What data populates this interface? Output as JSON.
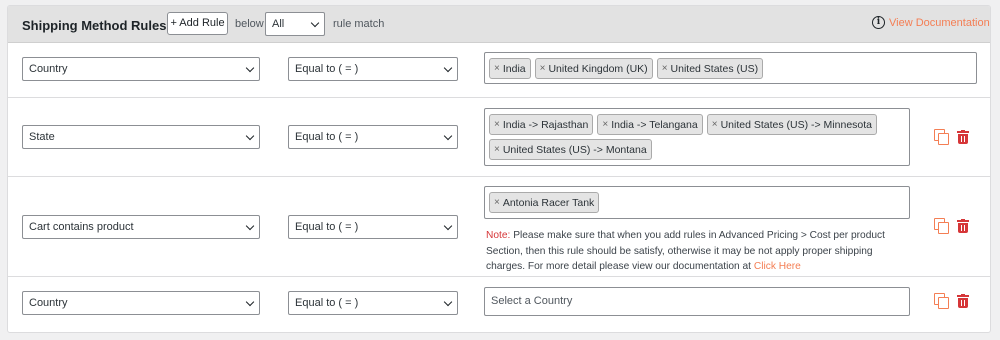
{
  "header": {
    "title": "Shipping Method Rules",
    "add_rule_label": "+ Add Rule",
    "below_label": "below",
    "match_select_value": "All",
    "rule_match_label": "rule match",
    "doc_link_label": "View Documentation",
    "doc_icon": "info-icon"
  },
  "colors": {
    "accent": "#f47e54",
    "danger": "#d63638",
    "header_bg": "#e2e2e2"
  },
  "rules": [
    {
      "field": "Country",
      "operator": "Equal to ( = )",
      "values": [
        "India",
        "United Kingdom (UK)",
        "United States (US)"
      ],
      "placeholder": ""
    },
    {
      "field": "State",
      "operator": "Equal to ( = )",
      "values": [
        "India -> Rajasthan",
        "India -> Telangana",
        "United States (US) -> Minnesota",
        "United States (US) -> Montana"
      ],
      "placeholder": ""
    },
    {
      "field": "Cart contains product",
      "operator": "Equal to ( = )",
      "values": [
        "Antonia Racer Tank"
      ],
      "placeholder": "",
      "note_label": "Note:",
      "note_text": " Please make sure that when you add rules in Advanced Pricing > Cost per product Section, then this rule should be satisfy, otherwise it may be not apply proper shipping charges. For more detail please view our documentation at ",
      "note_link": "Click Here"
    },
    {
      "field": "Country",
      "operator": "Equal to ( = )",
      "values": [],
      "placeholder": "Select a Country"
    }
  ],
  "tag_remove_symbol": "×"
}
